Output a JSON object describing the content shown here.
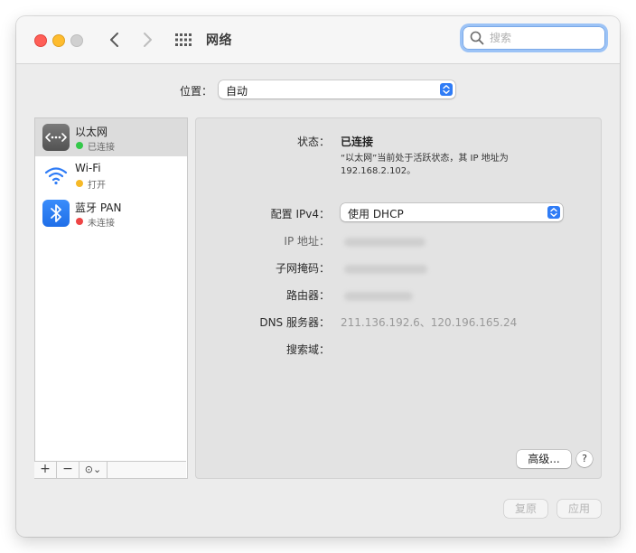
{
  "window": {
    "title": "网络"
  },
  "search": {
    "placeholder": "搜索",
    "value": ""
  },
  "location": {
    "label": "位置：",
    "value": "自动"
  },
  "services": [
    {
      "name": "以太网",
      "status": "已连接",
      "status_color": "#34c84a",
      "icon": "ethernet-icon"
    },
    {
      "name": "Wi-Fi",
      "status": "打开",
      "status_color": "#f6b927",
      "icon": "wifi-icon"
    },
    {
      "name": "蓝牙 PAN",
      "status": "未连接",
      "status_color": "#ee4545",
      "icon": "bluetooth-icon"
    }
  ],
  "sidebar_toolbar": {
    "add": "+",
    "remove": "−",
    "action": "⊙⌄"
  },
  "detail": {
    "status_label": "状态：",
    "status_value": "已连接",
    "status_desc": "“以太网”当前处于活跃状态，其 IP 地址为 192.168.2.102。",
    "config_label": "配置 IPv4：",
    "config_value": "使用 DHCP",
    "ip_label": "IP 地址：",
    "subnet_label": "子网掩码：",
    "router_label": "路由器：",
    "dns_label": "DNS 服务器：",
    "dns_value": "211.136.192.6、120.196.165.24",
    "search_domain_label": "搜索域：",
    "advanced_label": "高级...",
    "help_label": "?"
  },
  "buttons": {
    "revert": "复原",
    "apply": "应用"
  },
  "colors": {
    "accent": "#2f7cf6",
    "selection": "#dcdcdc"
  }
}
